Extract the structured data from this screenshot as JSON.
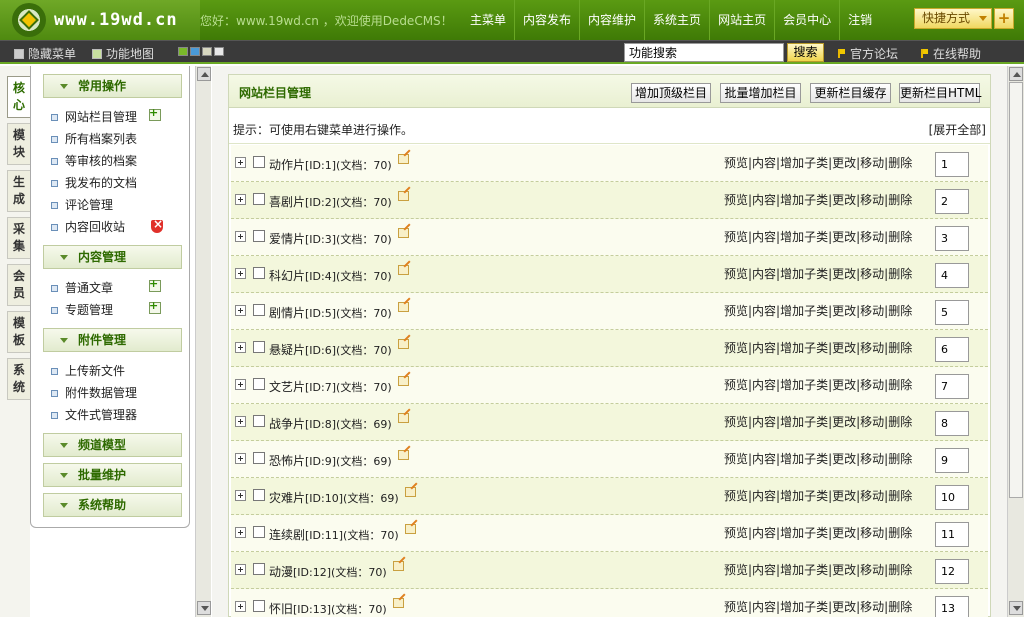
{
  "header": {
    "site": "www.19wd.cn",
    "welcome": "您好：www.19wd.cn ，欢迎使用DedeCMS！",
    "nav": [
      "主菜单",
      "内容发布",
      "内容维护",
      "系统主页",
      "网站主页",
      "会员中心",
      "注销"
    ],
    "quick": "快捷方式",
    "quick_plus": "+"
  },
  "toolbar": {
    "hide_menu": "隐藏菜单",
    "func_map": "功能地图",
    "search_value": "功能搜索",
    "search_btn": "搜索",
    "forum": "官方论坛",
    "help": "在线帮助",
    "swatch_colors": [
      "#7ab82a",
      "#4a9ad8",
      "#d8d8c0",
      "#e8e8e8"
    ]
  },
  "vtabs": [
    {
      "label": "核心",
      "active": true
    },
    {
      "label": "模块",
      "active": false
    },
    {
      "label": "生成",
      "active": false
    },
    {
      "label": "采集",
      "active": false
    },
    {
      "label": "会员",
      "active": false
    },
    {
      "label": "模板",
      "active": false
    },
    {
      "label": "系统",
      "active": false
    }
  ],
  "menu": {
    "sec_common": "常用操作",
    "common": [
      "网站栏目管理",
      "所有档案列表",
      "等审核的档案",
      "我发布的文档",
      "评论管理",
      "内容回收站"
    ],
    "sec_content": "内容管理",
    "content": [
      "普通文章",
      "专题管理"
    ],
    "sec_attach": "附件管理",
    "attach": [
      "上传新文件",
      "附件数据管理",
      "文件式管理器"
    ],
    "sec_channel": "频道模型",
    "sec_batch": "批量维护",
    "sec_help": "系统帮助"
  },
  "panel": {
    "title": "网站栏目管理",
    "btn_add_top": "增加顶级栏目",
    "btn_batch_add": "批量增加栏目",
    "btn_update_cache": "更新栏目缓存",
    "btn_update_html": "更新栏目HTML",
    "tip": "提示：可使用右键菜单进行操作。",
    "expand_all": "[展开全部]",
    "ops": "预览|内容|增加子类|更改|移动|删除",
    "rows": [
      {
        "name": "动作片",
        "id": "[ID:1]",
        "docs": "(文档：70)",
        "order": "1"
      },
      {
        "name": "喜剧片",
        "id": "[ID:2]",
        "docs": "(文档：70)",
        "order": "2"
      },
      {
        "name": "爱情片",
        "id": "[ID:3]",
        "docs": "(文档：70)",
        "order": "3"
      },
      {
        "name": "科幻片",
        "id": "[ID:4]",
        "docs": "(文档：70)",
        "order": "4"
      },
      {
        "name": "剧情片",
        "id": "[ID:5]",
        "docs": "(文档：70)",
        "order": "5"
      },
      {
        "name": "悬疑片",
        "id": "[ID:6]",
        "docs": "(文档：70)",
        "order": "6"
      },
      {
        "name": "文艺片",
        "id": "[ID:7]",
        "docs": "(文档：70)",
        "order": "7"
      },
      {
        "name": "战争片",
        "id": "[ID:8]",
        "docs": "(文档：69)",
        "order": "8"
      },
      {
        "name": "恐怖片",
        "id": "[ID:9]",
        "docs": "(文档：69)",
        "order": "9"
      },
      {
        "name": "灾难片",
        "id": "[ID:10]",
        "docs": "(文档：69)",
        "order": "10"
      },
      {
        "name": "连续剧",
        "id": "[ID:11]",
        "docs": "(文档：70)",
        "order": "11"
      },
      {
        "name": "动漫",
        "id": "[ID:12]",
        "docs": "(文档：70)",
        "order": "12"
      },
      {
        "name": "怀旧",
        "id": "[ID:13]",
        "docs": "(文档：70)",
        "order": "13"
      }
    ]
  }
}
